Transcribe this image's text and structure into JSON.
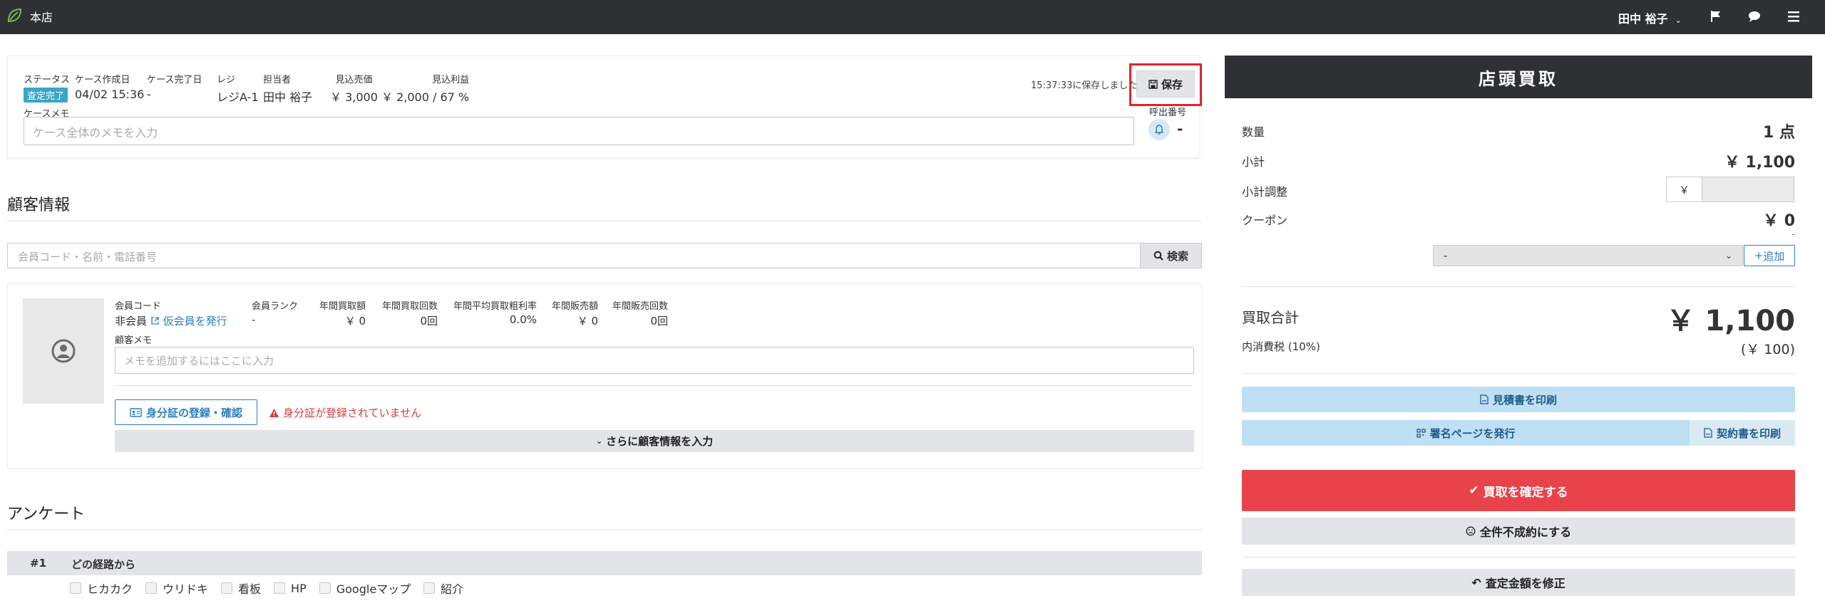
{
  "topbar": {
    "store_name": "本店",
    "user_name": "田中 裕子",
    "icons": [
      "leaf-logo-icon",
      "chevron-down-icon",
      "flag-icon",
      "chat-icon",
      "menu-icon"
    ]
  },
  "case": {
    "status_label": "ステータス",
    "status_badge": "査定完了",
    "created_label": "ケース作成日",
    "created_value": "04/02 15:36",
    "completed_label": "ケース完了日",
    "completed_value": "-",
    "register_label": "レジ",
    "register_value": "レジA-1",
    "staff_label": "担当者",
    "staff_value": "田中 裕子",
    "est_sales_label": "見込売価",
    "est_sales_value": "￥ 3,000",
    "est_profit_label": "見込利益",
    "est_profit_value": "￥ 2,000 / 67 %",
    "saved_text": "15:37:33に保存しました",
    "save_label": "保存",
    "memo_label": "ケースメモ",
    "memo_placeholder": "ケース全体のメモを入力",
    "call_label": "呼出番号",
    "call_value": "-"
  },
  "customer": {
    "section_title": "顧客情報",
    "search_placeholder": "会員コード・名前・電話番号",
    "search_label": "検索",
    "member_code_label": "会員コード",
    "member_code_value": "非会員",
    "temp_member_link": "仮会員を発行",
    "rank_label": "会員ランク",
    "rank_value": "-",
    "annual_buy_amount_label": "年間買取額",
    "annual_buy_amount_value": "￥ 0",
    "annual_buy_count_label": "年間買取回数",
    "annual_buy_count_value": "0回",
    "avg_margin_label": "年間平均買取粗利率",
    "avg_margin_value": "0.0%",
    "annual_sales_label": "年間販売額",
    "annual_sales_value": "￥ 0",
    "annual_sales_count_label": "年間販売回数",
    "annual_sales_count_value": "0回",
    "memo_label": "顧客メモ",
    "memo_placeholder": "メモを追加するにはここに入力",
    "id_button": "身分証の登録・確認",
    "id_warning": "身分証が登録されていません",
    "more_button": "さらに顧客情報を入力"
  },
  "survey": {
    "section_title": "アンケート",
    "question_num": "#1",
    "question_text": "どの経路から",
    "options": [
      "ヒカカク",
      "ウリドキ",
      "看板",
      "HP",
      "Googleマップ",
      "紹介"
    ]
  },
  "summary": {
    "title": "店頭買取",
    "qty_label": "数量",
    "qty_value": "1 点",
    "subtotal_label": "小計",
    "subtotal_value": "￥ 1,100",
    "adjust_label": "小計調整",
    "adjust_prefix": "￥",
    "coupon_label": "クーポン",
    "coupon_value": "￥ 0",
    "coupon_sub": "-",
    "coupon_select": "-",
    "coupon_add": "追加",
    "total_label": "買取合計",
    "total_value": "￥ 1,100",
    "tax_label": "内消費税 (10%)",
    "tax_value": "(￥ 100)",
    "print_estimate": "見積書を印刷",
    "issue_sign_page": "署名ページを発行",
    "print_contract": "契約書を印刷",
    "confirm_buy": "買取を確定する",
    "all_reject": "全件不成約にする",
    "fix_amount": "査定金額を修正"
  }
}
